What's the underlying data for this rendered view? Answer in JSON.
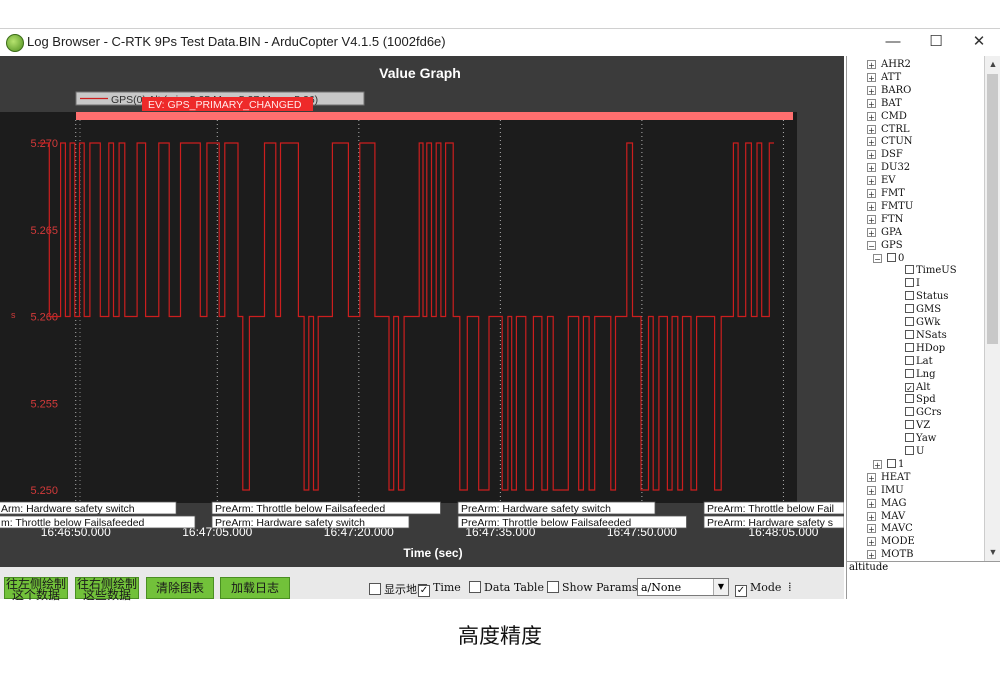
{
  "window": {
    "title": "Log Browser - C-RTK 9Ps Test Data.BIN - ArduCopter V4.1.5 (1002fd6e)",
    "controls": {
      "minimize": "—",
      "maximize": "☐",
      "close": "✕"
    }
  },
  "graph": {
    "title": "Value Graph",
    "legend_text": "GPS(0) Alt (min: 5.25 Max: 5.27 Mean: 5.26)",
    "event_label": "EV: GPS_PRIMARY_CHANGED",
    "side_marker": "s",
    "colors": {
      "line": "#cc1e1e",
      "background": "#1c1c1c",
      "frame": "#3b3b3b",
      "event_bar": "#ff6f6f"
    },
    "messages": [
      {
        "lines": [
          "Arm: Hardware safety switch",
          "m: Throttle below Failsafe",
          "eded"
        ]
      },
      {
        "lines": [
          "PreArm: Throttle below Failsafe",
          "eded",
          "PreArm: Hardware safety switch"
        ]
      },
      {
        "lines": [
          "PreArm: Hardware safety switch",
          "PreArm: Throttle below Failsafe",
          "eded"
        ]
      },
      {
        "lines": [
          "PreArm: Throttle below Fail",
          "PreArm: Hardware safety s"
        ]
      }
    ]
  },
  "chart_data": {
    "type": "line",
    "title": "Value Graph",
    "xlabel": "Time (sec)",
    "ylabel": "",
    "x_tick_labels": [
      "16:46:50.000",
      "16:47:05.000",
      "16:47:20.000",
      "16:47:35.000",
      "16:47:50.000",
      "16:48:05.000"
    ],
    "y_tick_labels": [
      "5.270",
      "5.265",
      "5.260",
      "5.255",
      "5.250"
    ],
    "xlim_sec": [
      0,
      78
    ],
    "ylim": [
      5.2485,
      5.2718
    ],
    "grid": true,
    "legend_position": "top-left",
    "series": [
      {
        "name": "GPS(0) Alt (min: 5.25 Max: 5.27 Mean: 5.26)",
        "x_sec": [
          0.0,
          1.0,
          1.2,
          2.2,
          2.4,
          2.7,
          2.9,
          3.2,
          3.4,
          3.7,
          3.9,
          4.2,
          4.4,
          4.7,
          4.9,
          5.3,
          5.5,
          6.4,
          6.6,
          7.3,
          7.5,
          7.8,
          8.0,
          8.4,
          8.6,
          9.0,
          9.2,
          10.3,
          10.5,
          11.2,
          11.4,
          12.6,
          12.8,
          13.7,
          13.9,
          14.5,
          14.8,
          14.9,
          15.1,
          17.0,
          17.2,
          17.7,
          17.9,
          19.0,
          19.2,
          19.6,
          19.8,
          21.0,
          21.2,
          21.5,
          21.7,
          22.2,
          22.4,
          23.8,
          24.0,
          25.0,
          25.2,
          25.5,
          25.7,
          27.4,
          27.6,
          28.0,
          28.2,
          28.5,
          28.7,
          29.0,
          29.2,
          29.5,
          29.7,
          30.0,
          30.2,
          31.0,
          31.2,
          32.7,
          32.9,
          33.9,
          34.1,
          35.5,
          35.7,
          37.0,
          37.2,
          37.5,
          37.7,
          38.0,
          38.2,
          38.6,
          38.8,
          40.2,
          40.4,
          40.6,
          40.8,
          41.0,
          41.2,
          41.5,
          41.7,
          42.0,
          42.2,
          42.5,
          42.7,
          43.0,
          43.2,
          43.8,
          44.0,
          44.5,
          44.7,
          45.3,
          45.5,
          46.5,
          46.7,
          47.6,
          47.8,
          48.5,
          48.7,
          49.0,
          49.2,
          49.6,
          49.8,
          50.0,
          50.2,
          50.5,
          50.7,
          51.5,
          51.7,
          52.3,
          52.5,
          53.2,
          53.4,
          53.8,
          54.0,
          54.4,
          54.6,
          56.0,
          56.2,
          56.6,
          56.8,
          57.1,
          57.3,
          57.6,
          57.8,
          58.2,
          58.4,
          58.8,
          59.0,
          60.5,
          60.7,
          61.0,
          61.2,
          62.2,
          62.4,
          62.8,
          63.0,
          63.7,
          63.9,
          64.5,
          64.7,
          65.0,
          65.2,
          65.6,
          65.8,
          66.5,
          66.7,
          67.0,
          67.2,
          67.6,
          67.8,
          68.1,
          68.3,
          69.0,
          69.2,
          69.6,
          69.8,
          71.5,
          71.7,
          72.2,
          72.4,
          73.5,
          73.7,
          74.0,
          74.2,
          74.8,
          75.0,
          75.4,
          75.6,
          76.0,
          76.2,
          76.5,
          76.7,
          77.3,
          77.5,
          78.0
        ],
        "y": [
          5.27,
          5.27,
          5.26,
          5.26,
          5.27,
          5.27,
          5.26,
          5.26,
          5.27,
          5.27,
          5.26,
          5.26,
          5.27,
          5.27,
          5.26,
          5.26,
          5.27,
          5.27,
          5.26,
          5.26,
          5.27,
          5.27,
          5.26,
          5.26,
          5.27,
          5.27,
          5.26,
          5.26,
          5.27,
          5.27,
          5.26,
          5.26,
          5.27,
          5.27,
          5.26,
          5.26,
          5.26,
          5.26,
          5.27,
          5.27,
          5.26,
          5.26,
          5.27,
          5.27,
          5.26,
          5.26,
          5.27,
          5.27,
          5.26,
          5.26,
          5.25,
          5.25,
          5.26,
          5.26,
          5.27,
          5.27,
          5.26,
          5.26,
          5.27,
          5.27,
          5.26,
          5.26,
          5.25,
          5.25,
          5.26,
          5.26,
          5.25,
          5.25,
          5.26,
          5.26,
          5.26,
          5.26,
          5.27,
          5.27,
          5.26,
          5.26,
          5.27,
          5.27,
          5.26,
          5.26,
          5.25,
          5.25,
          5.26,
          5.26,
          5.25,
          5.25,
          5.26,
          5.26,
          5.27,
          5.27,
          5.26,
          5.26,
          5.27,
          5.27,
          5.26,
          5.26,
          5.27,
          5.27,
          5.26,
          5.26,
          5.27,
          5.27,
          5.26,
          5.26,
          5.25,
          5.25,
          5.26,
          5.26,
          5.25,
          5.25,
          5.26,
          5.26,
          5.26,
          5.26,
          5.25,
          5.25,
          5.26,
          5.26,
          5.25,
          5.25,
          5.26,
          5.26,
          5.25,
          5.25,
          5.26,
          5.26,
          5.25,
          5.25,
          5.26,
          5.26,
          5.25,
          5.25,
          5.26,
          5.26,
          5.26,
          5.26,
          5.25,
          5.25,
          5.26,
          5.26,
          5.25,
          5.25,
          5.26,
          5.26,
          5.25,
          5.25,
          5.26,
          5.26,
          5.27,
          5.27,
          5.26,
          5.26,
          5.25,
          5.25,
          5.26,
          5.26,
          5.25,
          5.25,
          5.26,
          5.26,
          5.25,
          5.25,
          5.26,
          5.26,
          5.25,
          5.25,
          5.26,
          5.26,
          5.25,
          5.25,
          5.26,
          5.26,
          5.25,
          5.25,
          5.26,
          5.26,
          5.27,
          5.27,
          5.26,
          5.26,
          5.27,
          5.27,
          5.26,
          5.26,
          5.27,
          5.27,
          5.26,
          5.26,
          5.27,
          5.27,
          5.26,
          5.26,
          5.27,
          5.27,
          5.26,
          5.27,
          5.27
        ]
      }
    ]
  },
  "toolbar": {
    "buttons": [
      {
        "label": "往左侧绘制\n这个数据"
      },
      {
        "label": "往右侧绘制\n这些数据"
      },
      {
        "label": "清除图表"
      },
      {
        "label": "加载日志"
      }
    ],
    "checkboxes": [
      {
        "label": "显示地图",
        "checked": false
      },
      {
        "label": "Time",
        "checked": true
      },
      {
        "label": "Data Table",
        "checked": false
      },
      {
        "label": "Show Params",
        "checked": false
      }
    ],
    "combo_value": "a/None",
    "mode_label": "Mode",
    "mode_checked": true,
    "trailing_mark": "⁞"
  },
  "tree": {
    "top_items": [
      "AHR2",
      "ATT",
      "BARO",
      "BAT",
      "CMD",
      "CTRL",
      "CTUN",
      "DSF",
      "DU32",
      "EV",
      "FMT",
      "FMTU",
      "FTN",
      "GPA"
    ],
    "gps_label": "GPS",
    "gps0_label": "0",
    "gps0_fields": [
      {
        "label": "TimeUS",
        "checked": false
      },
      {
        "label": "I",
        "checked": false
      },
      {
        "label": "Status",
        "checked": false
      },
      {
        "label": "GMS",
        "checked": false
      },
      {
        "label": "GWk",
        "checked": false
      },
      {
        "label": "NSats",
        "checked": false
      },
      {
        "label": "HDop",
        "checked": false
      },
      {
        "label": "Lat",
        "checked": false
      },
      {
        "label": "Lng",
        "checked": false
      },
      {
        "label": "Alt",
        "checked": true
      },
      {
        "label": "Spd",
        "checked": false
      },
      {
        "label": "GCrs",
        "checked": false
      },
      {
        "label": "VZ",
        "checked": false
      },
      {
        "label": "Yaw",
        "checked": false
      },
      {
        "label": "U",
        "checked": false
      }
    ],
    "gps1_label": "1",
    "bottom_items": [
      "HEAT",
      "IMU",
      "MAG",
      "MAV",
      "MAVC",
      "MODE",
      "MOTB"
    ],
    "status_text": "altitude"
  },
  "caption": "高度精度"
}
